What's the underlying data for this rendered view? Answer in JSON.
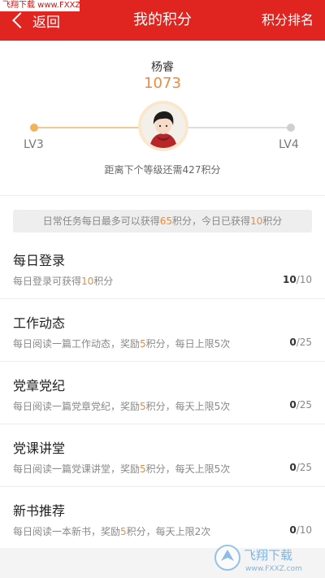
{
  "watermark": "飞翔下载 www.FXXZ.com",
  "header": {
    "back_label": "返回",
    "title": "我的积分",
    "rank_label": "积分排名"
  },
  "profile": {
    "name": "杨睿",
    "points": "1073",
    "level_current": "LV3",
    "level_next": "LV4",
    "needed_text": "距离下个等级还需427积分"
  },
  "summary": {
    "p1": "日常任务每日最多可以获得",
    "max": "65",
    "p2": "积分，今日已获得",
    "got": "10",
    "p3": "积分"
  },
  "tasks": [
    {
      "name": "每日登录",
      "d1": "每日登录可获得",
      "pts": "10",
      "d2": "积分",
      "done": "10",
      "total": "/10"
    },
    {
      "name": "工作动态",
      "d1": "每日阅读一篇工作动态，奖励",
      "pts": "5",
      "d2": "积分，每日上限5次",
      "done": "0",
      "total": "/25"
    },
    {
      "name": "党章党纪",
      "d1": "每日阅读一篇党章党纪，奖励",
      "pts": "5",
      "d2": "积分，每天上限5次",
      "done": "0",
      "total": "/25"
    },
    {
      "name": "党课讲堂",
      "d1": "每日阅读一篇党课讲堂，奖励",
      "pts": "5",
      "d2": "积分，每天上限5次",
      "done": "0",
      "total": "/25"
    },
    {
      "name": "新书推荐",
      "d1": "每日阅读一本新书，奖励",
      "pts": "5",
      "d2": "积分，每天上限2次",
      "done": "0",
      "total": "/10"
    }
  ],
  "bottom_watermark": {
    "text": "飞翔下载",
    "url": "www.FXXZ.com"
  },
  "colors": {
    "header": "#e0241f",
    "accent": "#f08a3b"
  }
}
